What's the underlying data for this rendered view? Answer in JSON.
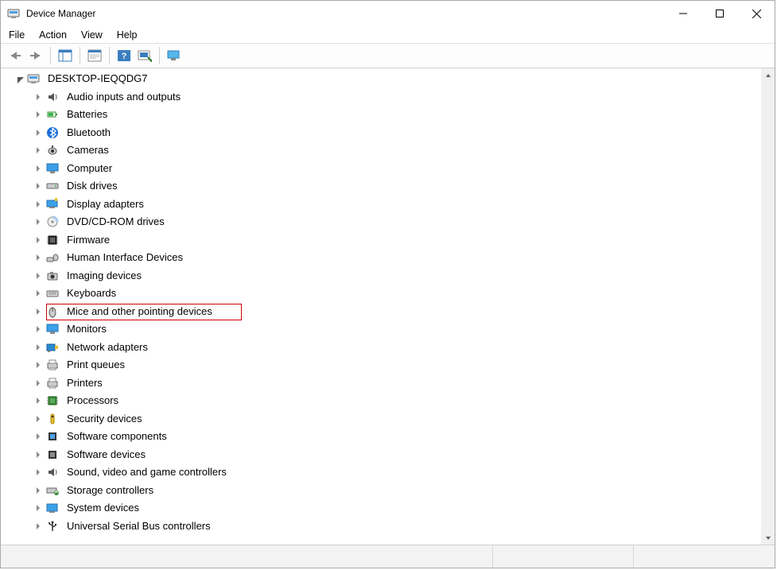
{
  "window": {
    "title": "Device Manager"
  },
  "menu": {
    "file": "File",
    "action": "Action",
    "view": "View",
    "help": "Help"
  },
  "tree": {
    "root": "DESKTOP-IEQQDG7",
    "items": [
      {
        "label": "Audio inputs and outputs"
      },
      {
        "label": "Batteries"
      },
      {
        "label": "Bluetooth"
      },
      {
        "label": "Cameras"
      },
      {
        "label": "Computer"
      },
      {
        "label": "Disk drives"
      },
      {
        "label": "Display adapters"
      },
      {
        "label": "DVD/CD-ROM drives"
      },
      {
        "label": "Firmware"
      },
      {
        "label": "Human Interface Devices"
      },
      {
        "label": "Imaging devices"
      },
      {
        "label": "Keyboards"
      },
      {
        "label": "Mice and other pointing devices",
        "highlight": true
      },
      {
        "label": "Monitors"
      },
      {
        "label": "Network adapters"
      },
      {
        "label": "Print queues"
      },
      {
        "label": "Printers"
      },
      {
        "label": "Processors"
      },
      {
        "label": "Security devices"
      },
      {
        "label": "Software components"
      },
      {
        "label": "Software devices"
      },
      {
        "label": "Sound, video and game controllers"
      },
      {
        "label": "Storage controllers"
      },
      {
        "label": "System devices"
      },
      {
        "label": "Universal Serial Bus controllers"
      }
    ]
  }
}
